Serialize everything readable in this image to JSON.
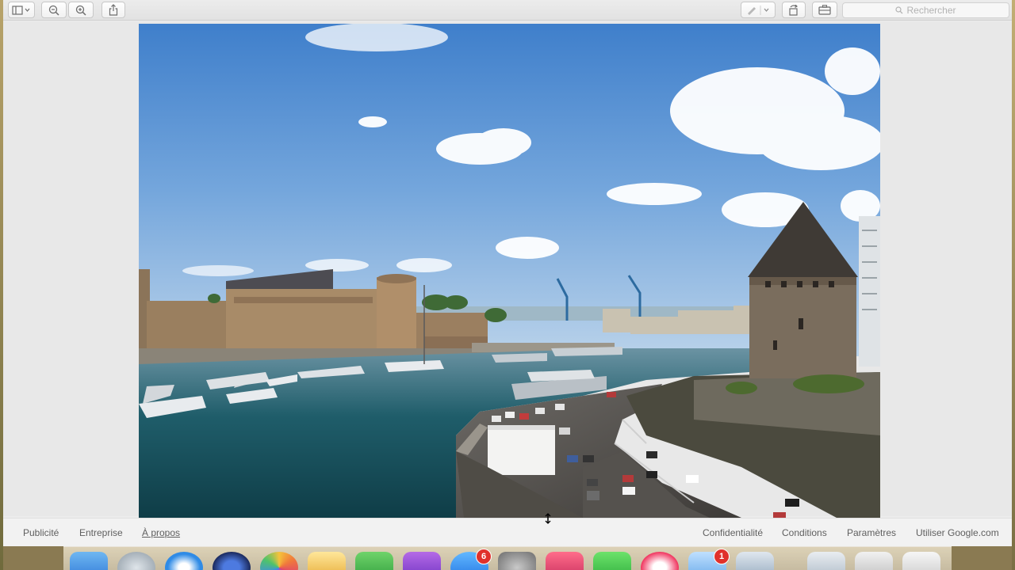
{
  "toolbar": {
    "search_placeholder": "Rechercher",
    "icons": [
      "sidebar-toggle-icon",
      "zoom-out-icon",
      "zoom-in-icon",
      "share-icon",
      "markup-pen-icon",
      "rotate-icon",
      "toolbox-icon"
    ]
  },
  "image": {
    "subject": "harbour-with-castle-and-tower"
  },
  "footer": {
    "left_links": [
      "Publicité",
      "Entreprise",
      "À propos"
    ],
    "right_links": [
      "Confidentialité",
      "Conditions",
      "Paramètres",
      "Utiliser Google.com"
    ]
  },
  "dock": {
    "badges": {
      "app_store": "6",
      "mail": "1"
    }
  },
  "colors": {
    "window_bg": "#ececec",
    "footer_text": "#5f5f5f",
    "badge_red": "#e0312b"
  }
}
